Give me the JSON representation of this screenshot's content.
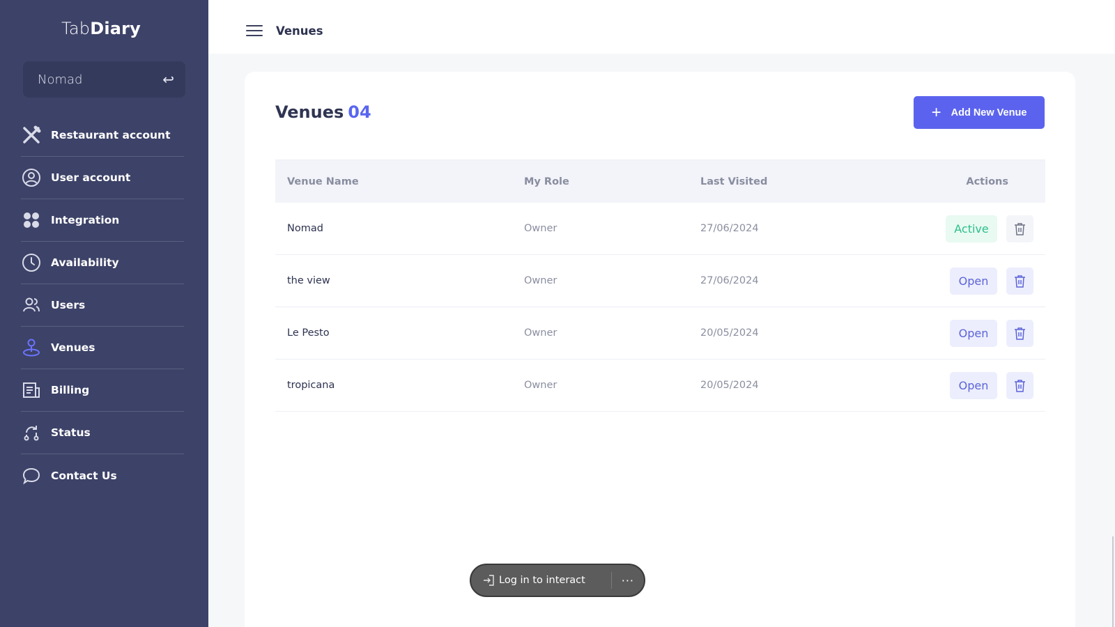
{
  "brand": {
    "light": "Tab",
    "bold": "Diary"
  },
  "venue_selector": {
    "value": "Nomad",
    "icon": "return-icon"
  },
  "sidebar": {
    "items": [
      {
        "label": "Restaurant account",
        "icon": "utensils-icon"
      },
      {
        "label": "User account",
        "icon": "user-circle-icon"
      },
      {
        "label": "Integration",
        "icon": "grid-dots-icon"
      },
      {
        "label": "Availability",
        "icon": "clock-icon"
      },
      {
        "label": "Users",
        "icon": "users-icon"
      },
      {
        "label": "Venues",
        "icon": "venue-pin-icon",
        "active": true
      },
      {
        "label": "Billing",
        "icon": "billing-icon"
      },
      {
        "label": "Status",
        "icon": "status-icon"
      },
      {
        "label": "Contact Us",
        "icon": "chat-icon"
      }
    ]
  },
  "topbar": {
    "title": "Venues"
  },
  "card": {
    "title": "Venues",
    "count": "04",
    "add_button": "Add New Venue"
  },
  "table": {
    "headers": [
      "Venue Name",
      "My Role",
      "Last Visited",
      "Actions"
    ],
    "rows": [
      {
        "name": "Nomad",
        "role": "Owner",
        "last_visited": "27/06/2024",
        "action": "Active"
      },
      {
        "name": "the view",
        "role": "Owner",
        "last_visited": "27/06/2024",
        "action": "Open"
      },
      {
        "name": "Le Pesto",
        "role": "Owner",
        "last_visited": "20/05/2024",
        "action": "Open"
      },
      {
        "name": "tropicana",
        "role": "Owner",
        "last_visited": "20/05/2024",
        "action": "Open"
      }
    ]
  },
  "overlay": {
    "login_label": "Log in to interact",
    "more": "···"
  },
  "colors": {
    "sidebar_bg": "#3d4268",
    "accent": "#5b63ee",
    "active_green": "#2dbf8a",
    "venue_icon": "#6b74ff"
  }
}
